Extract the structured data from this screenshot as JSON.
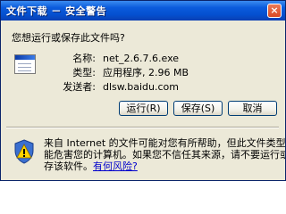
{
  "window": {
    "title": "文件下载 － 安全警告",
    "close_label": "×"
  },
  "prompt": "您想运行或保存此文件吗?",
  "file": {
    "icon": "exe-file-icon",
    "fields": [
      {
        "label": "名称:",
        "value": "net_2.6.7.6.exe"
      },
      {
        "label": "类型:",
        "value": "应用程序, 2.96 MB"
      },
      {
        "label": "发送者:",
        "value": "dlsw.baidu.com"
      }
    ]
  },
  "buttons": {
    "run": "运行(R)",
    "save": "保存(S)",
    "cancel": "取消"
  },
  "warning": {
    "icon": "shield-warning-icon",
    "line1": "来自 Internet 的文件可能对您有所帮助，但此文件类型可",
    "line2": "能危害您的计算机。如果您不信任其来源，请不要运行或保",
    "line3_prefix": "存该软件。",
    "link": "有何风险?"
  },
  "colors": {
    "titlebar": "#0450d0",
    "dialog_bg": "#ece9d8",
    "button_border": "#003c74",
    "link": "#0000cc"
  }
}
